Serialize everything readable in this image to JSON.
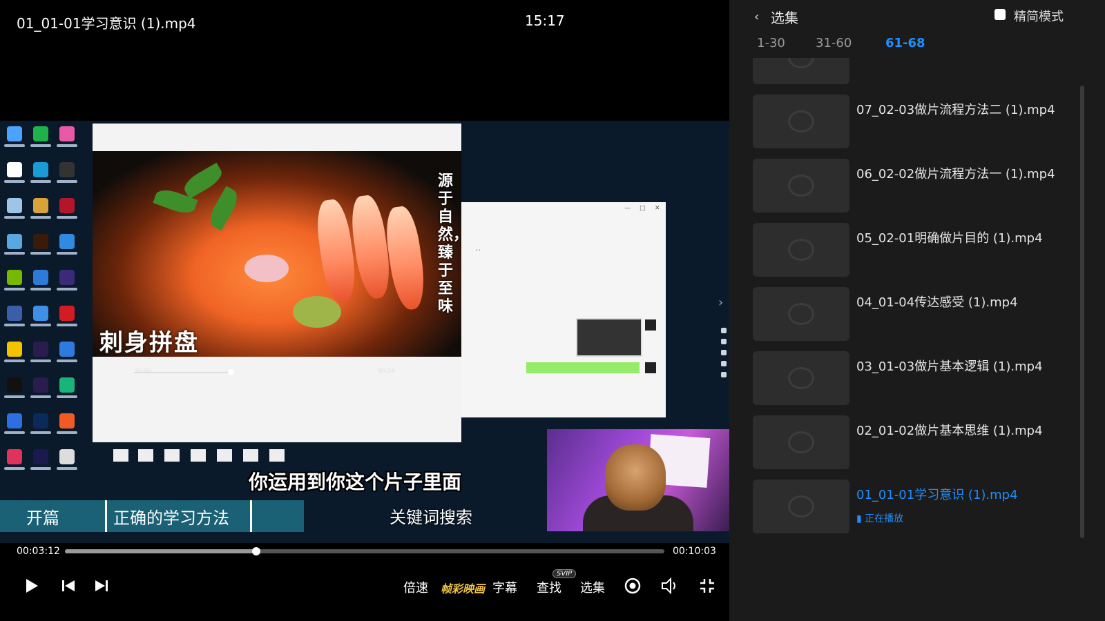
{
  "header": {
    "title": "01_01-01学习意识 (1).mp4",
    "clock": "15:17"
  },
  "video": {
    "food_vertical_text": "源于自然，臻于至味",
    "food_caption": "刺身拼盘",
    "food_time_current": "00:08",
    "food_time_total": "00:24",
    "subtitle": "你运用到你这个片子里面",
    "chapter_1": "开篇",
    "chapter_2": "正确的学习方法",
    "keyword": "关键词搜索"
  },
  "player": {
    "time_current": "00:03:12",
    "time_total": "00:10:03",
    "progress_fraction": 0.319,
    "speed_label": "倍速",
    "effects_label": "帧彩映画",
    "captions_label": "字幕",
    "search_label": "查找",
    "search_badge": "SVIP",
    "episodes_label": "选集"
  },
  "sidebar": {
    "title": "选集",
    "mode_label": "精简模式",
    "tabs": [
      {
        "label": "1-30"
      },
      {
        "label": "31-60"
      },
      {
        "label": "61-68"
      }
    ],
    "episodes": [
      {
        "title": ""
      },
      {
        "title": "07_02-03做片流程方法二 (1).mp4"
      },
      {
        "title": "06_02-02做片流程方法一 (1).mp4"
      },
      {
        "title": "05_02-01明确做片目的 (1).mp4"
      },
      {
        "title": "04_01-04传达感受 (1).mp4"
      },
      {
        "title": "03_01-03做片基本逻辑 (1).mp4"
      },
      {
        "title": "02_01-02做片基本思维 (1).mp4"
      },
      {
        "title": "01_01-01学习意识 (1).mp4"
      }
    ],
    "now_playing": "正在播放"
  },
  "colors": {
    "accent": "#1e8fff",
    "effects": "#f4c54a"
  }
}
